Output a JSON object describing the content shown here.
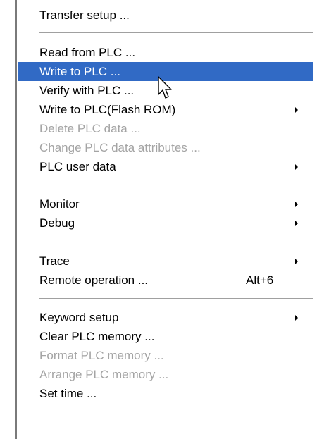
{
  "menu": {
    "items": [
      {
        "label": "Transfer setup ..."
      },
      {
        "label": "Read from PLC ..."
      },
      {
        "label": "Write to PLC ..."
      },
      {
        "label": "Verify with PLC ..."
      },
      {
        "label": "Write to PLC(Flash ROM)"
      },
      {
        "label": "Delete PLC data ..."
      },
      {
        "label": "Change PLC data attributes ..."
      },
      {
        "label": "PLC user data"
      },
      {
        "label": "Monitor"
      },
      {
        "label": "Debug"
      },
      {
        "label": "Trace"
      },
      {
        "label": "Remote operation ...",
        "shortcut": "Alt+6"
      },
      {
        "label": "Keyword setup"
      },
      {
        "label": "Clear PLC memory ..."
      },
      {
        "label": "Format PLC memory ..."
      },
      {
        "label": "Arrange PLC memory ..."
      },
      {
        "label": "Set time ..."
      }
    ]
  },
  "colors": {
    "highlight_bg": "#316ac5",
    "highlight_text": "#ffffff",
    "disabled_text": "#a4a4a4",
    "separator": "#a0a0a0"
  },
  "icons": {
    "submenu": "submenu-arrow-icon",
    "pointer": "mouse-pointer-icon"
  }
}
